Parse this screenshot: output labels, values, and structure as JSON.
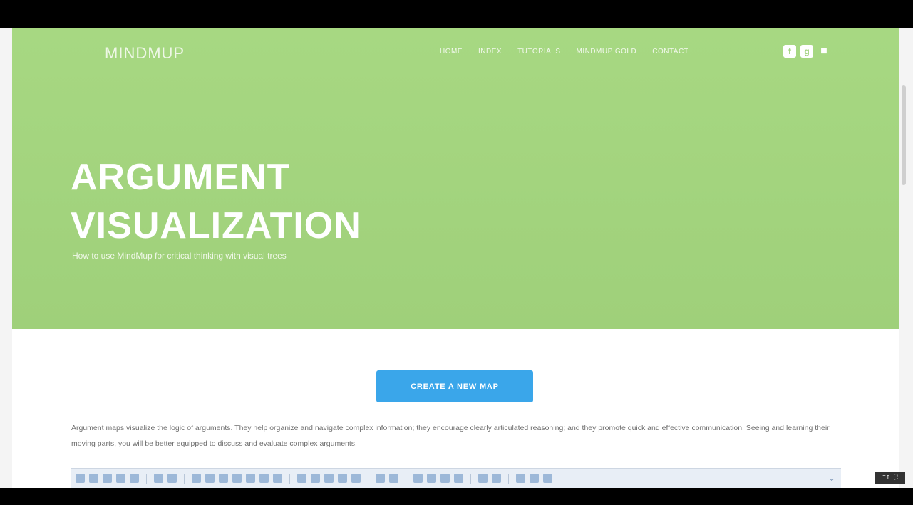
{
  "header": {
    "brand": "MINDMUP",
    "nav": [
      "HOME",
      "INDEX",
      "TUTORIALS",
      "MINDMUP GOLD",
      "CONTACT"
    ],
    "social_icons": [
      "facebook-icon",
      "google-plus-icon",
      "user-icon"
    ]
  },
  "hero": {
    "title_line1": "ARGUMENT",
    "title_line2": "VISUALIZATION",
    "subtitle": "How to use MindMup for critical thinking with visual trees"
  },
  "main": {
    "cta_label": "CREATE A NEW MAP",
    "intro_text": "Argument maps visualize the logic of arguments. They help organize and navigate complex information; they encourage clearly articulated reasoning; and they promote quick and effective communication. Seeing and learning their moving parts, you will be better equipped to discuss and evaluate complex arguments."
  },
  "toolbar": {
    "icons": [
      "undo-icon",
      "redo-icon",
      "add-child-icon",
      "add-sibling-icon",
      "remove-icon",
      "edit-icon",
      "insert-icon",
      "collapse-icon",
      "expand-icon",
      "link-icon",
      "image-icon",
      "attachment-icon",
      "note-icon",
      "pencil-icon",
      "search-icon",
      "left-icon",
      "right-icon",
      "up-icon",
      "down-icon",
      "copy-icon",
      "paste-icon",
      "zoom-in-icon",
      "zoom-out-icon",
      "reset-zoom-icon",
      "layout-icon",
      "center-icon",
      "list-icon",
      "share-icon",
      "back-icon",
      "settings-icon"
    ]
  },
  "video": {
    "badge": "II ⛶"
  },
  "colors": {
    "hero_green": "#a7d882",
    "cta_blue": "#3aa6ea"
  }
}
